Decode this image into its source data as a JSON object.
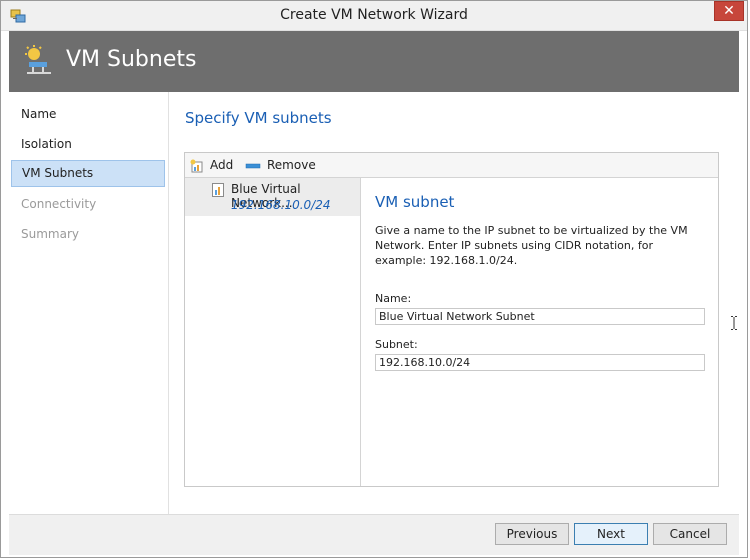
{
  "window": {
    "title": "Create VM Network Wizard",
    "close_symbol": "✕"
  },
  "header": {
    "title": "VM Subnets",
    "icon": "network-wizard-icon"
  },
  "nav": {
    "items": [
      {
        "label": "Name",
        "state": "enabled"
      },
      {
        "label": "Isolation",
        "state": "enabled"
      },
      {
        "label": "VM Subnets",
        "state": "selected"
      },
      {
        "label": "Connectivity",
        "state": "disabled"
      },
      {
        "label": "Summary",
        "state": "disabled"
      }
    ]
  },
  "main": {
    "heading": "Specify VM subnets",
    "toolbar": {
      "add_label": "Add",
      "remove_label": "Remove"
    },
    "subnet_list": [
      {
        "name": "Blue Virtual Network...",
        "subnet": "192.168.10.0/24"
      }
    ],
    "detail": {
      "heading": "VM subnet",
      "description": "Give a name to the IP subnet to be virtualized by the VM Network. Enter IP subnets using CIDR notation, for example: 192.168.1.0/24.",
      "name_label": "Name:",
      "name_value": "Blue Virtual Network Subnet",
      "subnet_label": "Subnet:",
      "subnet_value": "192.168.10.0/24"
    }
  },
  "footer": {
    "previous_label": "Previous",
    "next_label": "Next",
    "cancel_label": "Cancel"
  },
  "colors": {
    "header_band": "#6e6e6e",
    "accent_blue": "#1a5fb4",
    "nav_selected": "#cce1f7",
    "close_red": "#c7463b"
  }
}
